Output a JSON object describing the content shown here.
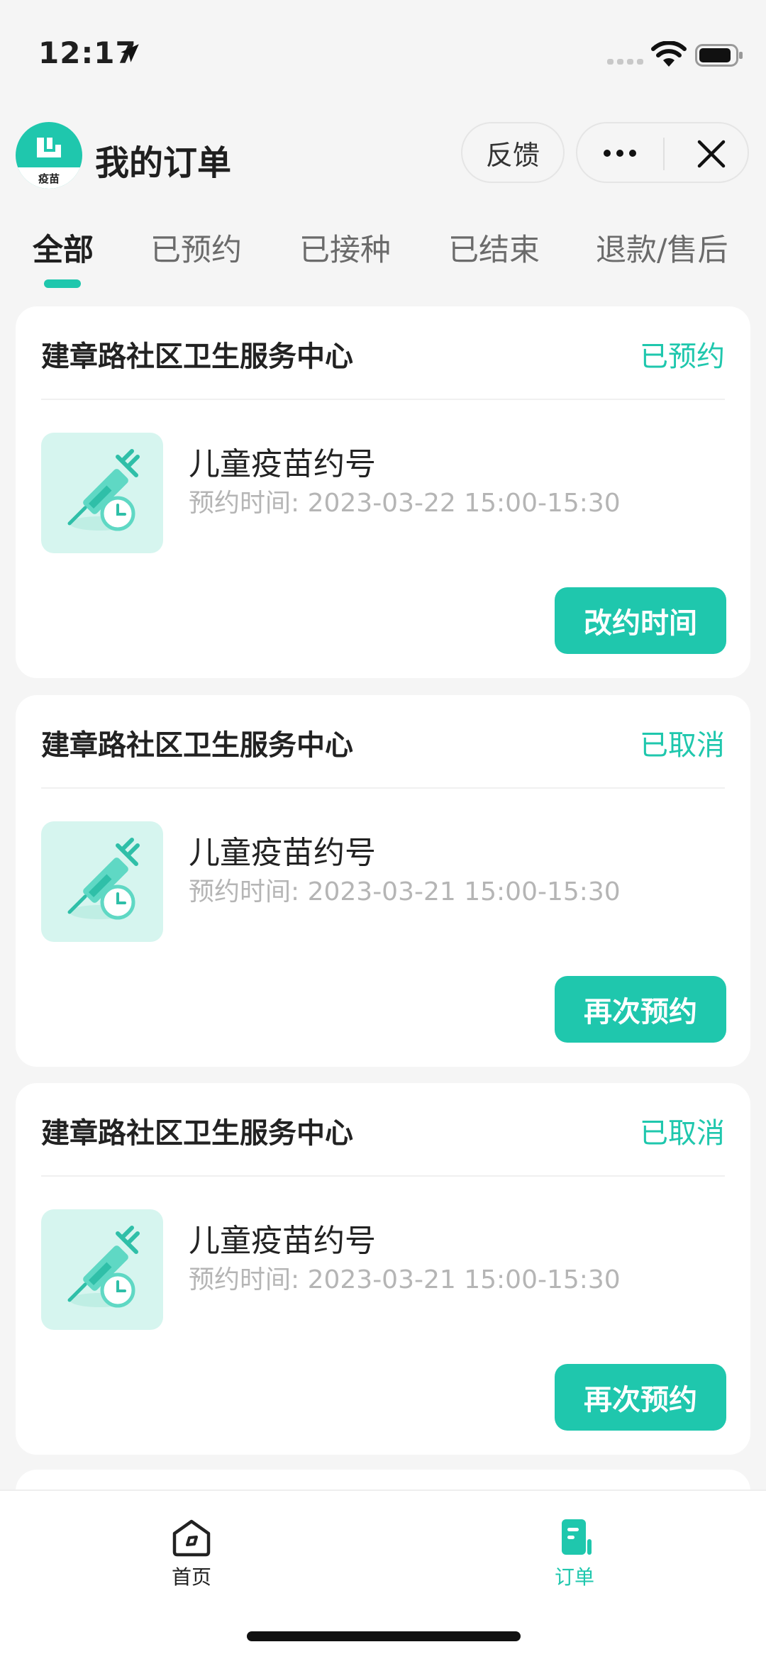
{
  "status_bar": {
    "time": "12:17"
  },
  "header": {
    "logo_text": "疫苗",
    "title": "我的订单",
    "feedback_label": "反馈"
  },
  "tabs": [
    {
      "label": "全部",
      "active": true
    },
    {
      "label": "已预约",
      "active": false
    },
    {
      "label": "已接种",
      "active": false
    },
    {
      "label": "已结束",
      "active": false
    },
    {
      "label": "退款/售后",
      "active": false
    }
  ],
  "orders": [
    {
      "org": "建章路社区卫生服务中心",
      "status": "已预约",
      "item": "儿童疫苗约号",
      "time": "预约时间: 2023-03-22 15:00-15:30",
      "action": "改约时间"
    },
    {
      "org": "建章路社区卫生服务中心",
      "status": "已取消",
      "item": "儿童疫苗约号",
      "time": "预约时间: 2023-03-21 15:00-15:30",
      "action": "再次预约"
    },
    {
      "org": "建章路社区卫生服务中心",
      "status": "已取消",
      "item": "儿童疫苗约号",
      "time": "预约时间: 2023-03-21 15:00-15:30",
      "action": "再次预约"
    }
  ],
  "bottom_nav": [
    {
      "label": "首页",
      "icon": "home-icon",
      "active": false
    },
    {
      "label": "订单",
      "icon": "order-icon",
      "active": true
    }
  ],
  "colors": {
    "accent": "#1fc7ad",
    "thumb_bg": "#d6f5ef",
    "muted_text": "#b5b5b5"
  }
}
